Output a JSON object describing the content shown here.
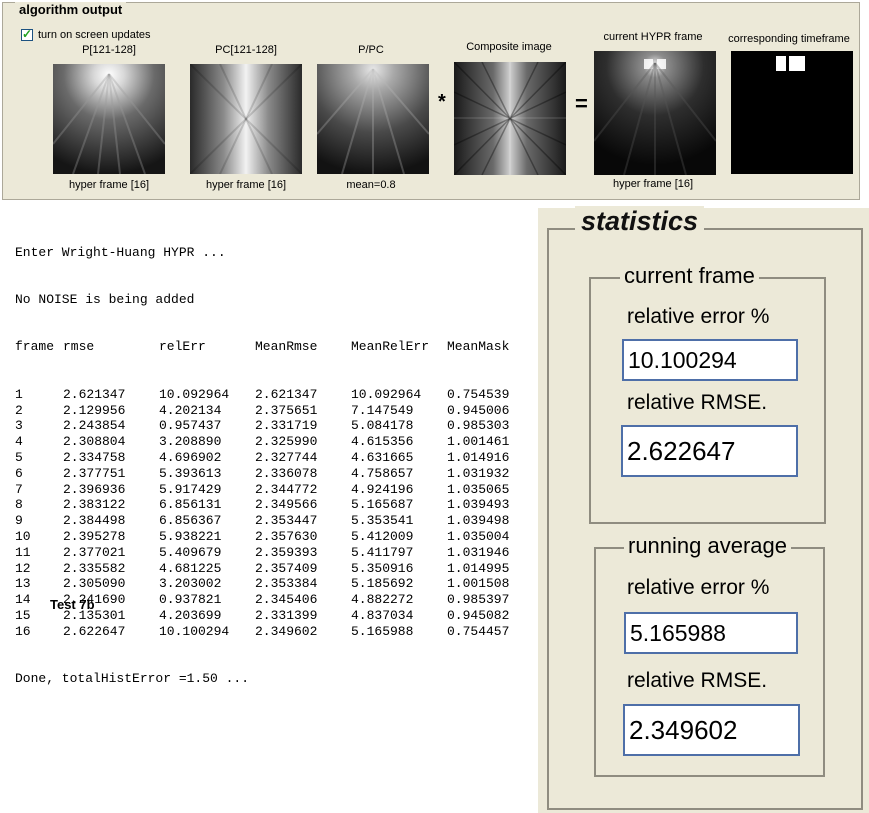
{
  "algo": {
    "title": "algorithm output",
    "checkbox_label": "turn on screen updates",
    "panels": [
      {
        "top": "P[121-128]",
        "bottom": "hyper frame [16]"
      },
      {
        "top": "PC[121-128]",
        "bottom": "hyper frame [16]"
      },
      {
        "top": "P/PC",
        "bottom": "mean=0.8"
      },
      {
        "top": "Composite image",
        "bottom": ""
      },
      {
        "top": "current HYPR frame",
        "bottom": "hyper frame [16]"
      },
      {
        "top": "corresponding timeframe",
        "bottom": ""
      }
    ],
    "op_multiply": "*",
    "op_equals": "="
  },
  "console": {
    "line1": "Enter Wright-Huang HYPR ...",
    "line2": "No NOISE is being added",
    "headers": [
      "frame",
      "rmse",
      "relErr",
      "MeanRmse",
      "MeanRelErr",
      "MeanMask"
    ],
    "rows": [
      [
        "1",
        "2.621347",
        "10.092964",
        "2.621347",
        "10.092964",
        "0.754539"
      ],
      [
        "2",
        "2.129956",
        "4.202134",
        "2.375651",
        "7.147549",
        "0.945006"
      ],
      [
        "3",
        "2.243854",
        "0.957437",
        "2.331719",
        "5.084178",
        "0.985303"
      ],
      [
        "4",
        "2.308804",
        "3.208890",
        "2.325990",
        "4.615356",
        "1.001461"
      ],
      [
        "5",
        "2.334758",
        "4.696902",
        "2.327744",
        "4.631665",
        "1.014916"
      ],
      [
        "6",
        "2.377751",
        "5.393613",
        "2.336078",
        "4.758657",
        "1.031932"
      ],
      [
        "7",
        "2.396936",
        "5.917429",
        "2.344772",
        "4.924196",
        "1.035065"
      ],
      [
        "8",
        "2.383122",
        "6.856131",
        "2.349566",
        "5.165687",
        "1.039493"
      ],
      [
        "9",
        "2.384498",
        "6.856367",
        "2.353447",
        "5.353541",
        "1.039498"
      ],
      [
        "10",
        "2.395278",
        "5.938221",
        "2.357630",
        "5.412009",
        "1.035004"
      ],
      [
        "11",
        "2.377021",
        "5.409679",
        "2.359393",
        "5.411797",
        "1.031946"
      ],
      [
        "12",
        "2.335582",
        "4.681225",
        "2.357409",
        "5.350916",
        "1.014995"
      ],
      [
        "13",
        "2.305090",
        "3.203002",
        "2.353384",
        "5.185692",
        "1.001508"
      ],
      [
        "14",
        "2.241690",
        "0.937821",
        "2.345406",
        "4.882272",
        "0.985397"
      ],
      [
        "15",
        "2.135301",
        "4.203699",
        "2.331399",
        "4.837034",
        "0.945082"
      ],
      [
        "16",
        "2.622647",
        "10.100294",
        "2.349602",
        "5.165988",
        "0.754457"
      ]
    ],
    "done_line": "Done, totalHistError =1.50 ..."
  },
  "test_label": "Test 7b",
  "stats": {
    "title": "statistics",
    "current": {
      "title": "current frame",
      "rel_err_label": "relative error %",
      "rel_err_value": "10.100294",
      "rmse_label": "relative RMSE.",
      "rmse_value": "2.622647"
    },
    "running": {
      "title": "running average",
      "rel_err_label": "relative error %",
      "rel_err_value": "5.165988",
      "rmse_label": "relative RMSE.",
      "rmse_value": "2.349602"
    }
  }
}
